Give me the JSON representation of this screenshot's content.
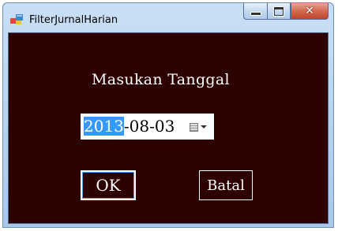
{
  "window": {
    "title": "FilterJurnalHarian"
  },
  "caption": {
    "minimize": "—",
    "maximize": "□",
    "close": "✕"
  },
  "form": {
    "label": "Masukan Tanggal",
    "date": {
      "selected": "2013",
      "rest": "-08-03"
    },
    "ok_label": "OK",
    "cancel_label": "Batal"
  },
  "colors": {
    "background": "#2c0100",
    "selection": "#3399ff",
    "titlebar": "#b9d3ef",
    "close": "#c94f36"
  }
}
